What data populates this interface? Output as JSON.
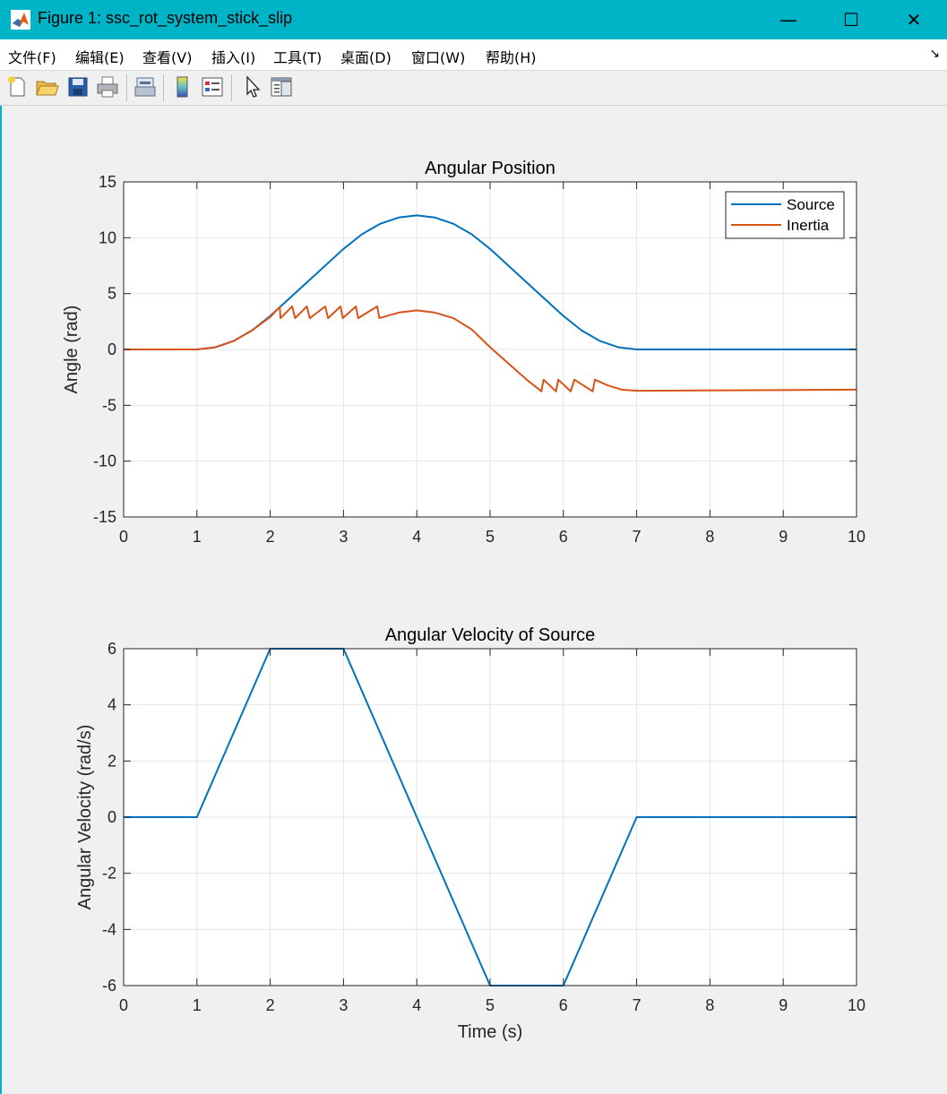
{
  "window": {
    "title": "Figure 1: ssc_rot_system_stick_slip",
    "minimize_glyph": "—",
    "maximize_glyph": "☐",
    "close_glyph": "✕"
  },
  "menu": {
    "items": [
      "文件(F)",
      "编辑(E)",
      "查看(V)",
      "插入(I)",
      "工具(T)",
      "桌面(D)",
      "窗口(W)",
      "帮助(H)"
    ],
    "dock_glyph": "↘"
  },
  "toolbar": {
    "icons": [
      "new-figure-icon",
      "open-folder-icon",
      "save-icon",
      "print-icon",
      "link-plot-icon",
      "colorbar-icon",
      "legend-icon",
      "pointer-icon",
      "property-inspector-icon"
    ]
  },
  "colors": {
    "source": "#0072bd",
    "inertia": "#d95319",
    "titlebar": "#00b4c8"
  },
  "chart_data": [
    {
      "type": "line",
      "title": "Angular Position",
      "xlabel": "",
      "ylabel": "Angle (rad)",
      "xlim": [
        0,
        10
      ],
      "ylim": [
        -15,
        15
      ],
      "xticks": [
        0,
        1,
        2,
        3,
        4,
        5,
        6,
        7,
        8,
        9,
        10
      ],
      "yticks": [
        15,
        10,
        5,
        0,
        -5,
        -10,
        -15
      ],
      "grid": true,
      "legend_position": "top-right",
      "series": [
        {
          "name": "Source",
          "x": [
            0,
            1,
            1.25,
            1.5,
            1.75,
            2,
            2.5,
            3,
            3.25,
            3.5,
            3.75,
            4,
            4.25,
            4.5,
            4.75,
            5,
            5.5,
            6,
            6.25,
            6.5,
            6.75,
            7,
            10
          ],
          "y": [
            0,
            0,
            0.19,
            0.75,
            1.69,
            3,
            6,
            9,
            10.31,
            11.25,
            11.81,
            12,
            11.81,
            11.25,
            10.31,
            9,
            6,
            3,
            1.69,
            0.75,
            0.19,
            0,
            0
          ]
        },
        {
          "name": "Inertia",
          "x": [
            0,
            1,
            1.25,
            1.5,
            1.75,
            2,
            2.13,
            2.14,
            2.3,
            2.34,
            2.5,
            2.54,
            2.75,
            2.79,
            2.96,
            2.99,
            3.17,
            3.2,
            3.46,
            3.49,
            3.75,
            4,
            4.25,
            4.5,
            4.75,
            5,
            5.5,
            5.7,
            5.73,
            5.9,
            5.93,
            6.1,
            6.15,
            6.4,
            6.43,
            6.6,
            6.8,
            7,
            10
          ],
          "y": [
            0,
            0,
            0.19,
            0.75,
            1.69,
            2.9,
            3.8,
            2.8,
            3.85,
            2.8,
            3.85,
            2.8,
            3.85,
            2.8,
            3.85,
            2.8,
            3.85,
            2.8,
            3.85,
            2.8,
            3.3,
            3.5,
            3.3,
            2.8,
            1.8,
            0.2,
            -2.7,
            -3.75,
            -2.7,
            -3.75,
            -2.7,
            -3.75,
            -2.7,
            -3.75,
            -2.7,
            -3.2,
            -3.6,
            -3.7,
            -3.6
          ]
        }
      ]
    },
    {
      "type": "line",
      "title": "Angular Velocity of Source",
      "xlabel": "Time (s)",
      "ylabel": "Angular Velocity (rad/s)",
      "xlim": [
        0,
        10
      ],
      "ylim": [
        -6,
        6
      ],
      "xticks": [
        0,
        1,
        2,
        3,
        4,
        5,
        6,
        7,
        8,
        9,
        10
      ],
      "yticks": [
        6,
        4,
        2,
        0,
        -2,
        -4,
        -6
      ],
      "grid": true,
      "series": [
        {
          "x": [
            0,
            1,
            2,
            3,
            4,
            5,
            6,
            7,
            10
          ],
          "y": [
            0,
            0,
            6,
            6,
            0,
            -6,
            -6,
            0,
            0
          ]
        }
      ]
    }
  ]
}
